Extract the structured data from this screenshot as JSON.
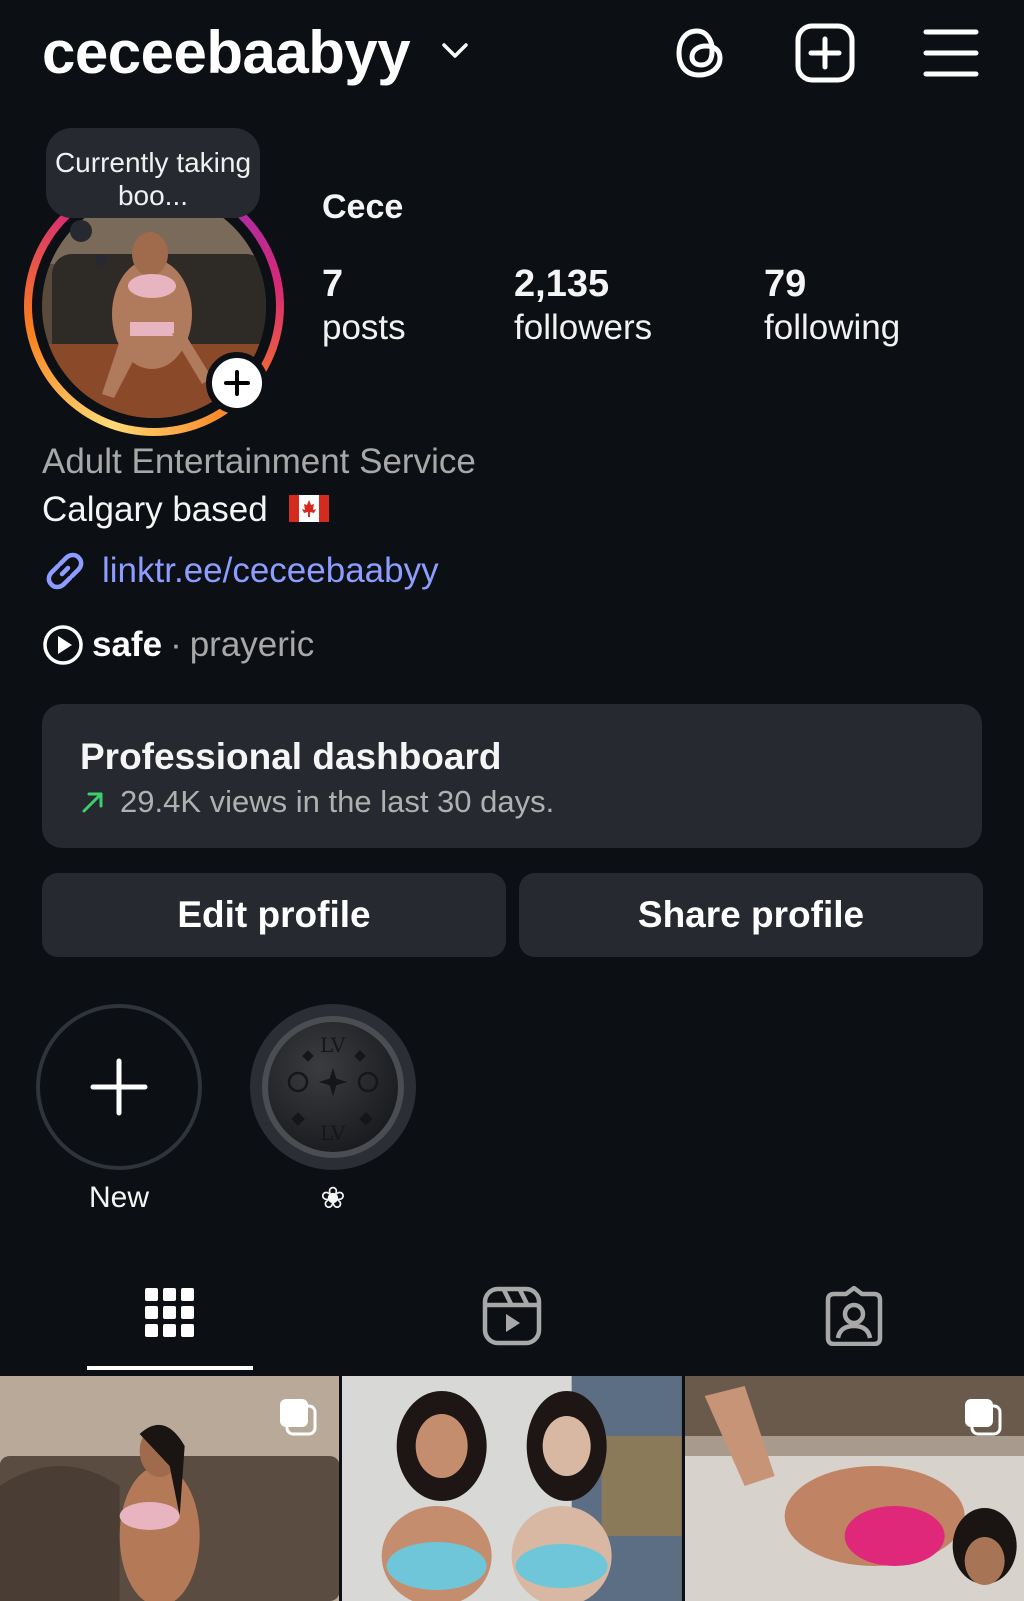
{
  "header": {
    "username": "ceceebaabyy",
    "icons": [
      "threads-icon",
      "create-icon",
      "menu-icon"
    ]
  },
  "profile": {
    "note": "Currently taking boo...",
    "display_name": "Cece",
    "stats": {
      "posts_count": "7",
      "posts_label": "posts",
      "followers_count": "2,135",
      "followers_label": "followers",
      "following_count": "79",
      "following_label": "following"
    },
    "category": "Adult Entertainment Service",
    "bio": "Calgary based",
    "link": "linktr.ee/ceceebaabyy",
    "music": {
      "song": "safe",
      "separator": "·",
      "artist": "prayeric"
    }
  },
  "dashboard": {
    "title": "Professional dashboard",
    "subtitle": "29.4K views in the last 30 days."
  },
  "buttons": {
    "edit": "Edit profile",
    "share": "Share profile"
  },
  "highlights": [
    {
      "label": "New"
    },
    {
      "label": "❀"
    }
  ],
  "tabs": [
    "grid-tab",
    "reels-tab",
    "tagged-tab"
  ],
  "colors": {
    "background": "#0c1014",
    "card": "#262a30",
    "link": "#8c9cff",
    "accent_green": "#3ccf6e"
  }
}
